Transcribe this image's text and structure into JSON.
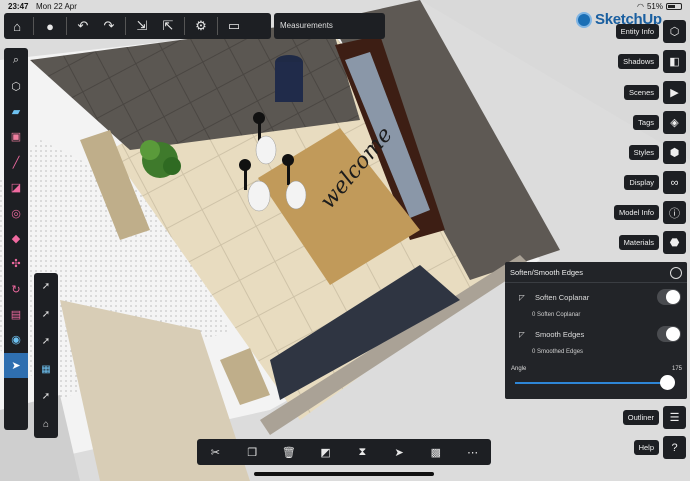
{
  "status": {
    "time": "23:47",
    "date": "Mon 22 Apr",
    "battery": "51%"
  },
  "logo": {
    "text": "SketchUp"
  },
  "measurements": {
    "label": "Measurements"
  },
  "top_toolbar": {
    "icons": [
      "home-icon",
      "user-icon",
      "undo-icon",
      "redo-icon",
      "import-icon",
      "export-icon",
      "settings-icon",
      "view-icon"
    ]
  },
  "left_tools": [
    "search-icon",
    "orbit-icon",
    "eraser-icon",
    "push-pull-icon",
    "line-icon",
    "rectangle-icon",
    "circle-icon",
    "paint-icon",
    "move-icon",
    "rotate-icon",
    "section-icon",
    "tape-icon",
    "select-icon"
  ],
  "sub_tools": [
    "arrow-plus-icon",
    "arrow-icon",
    "arrow-plus-icon",
    "grid-icon",
    "arrow-plus-icon",
    "hat-icon"
  ],
  "right_panel": [
    {
      "label": "Entity Info",
      "icon": "cube-icon"
    },
    {
      "label": "Shadows",
      "icon": "shadow-icon"
    },
    {
      "label": "Scenes",
      "icon": "scene-icon"
    },
    {
      "label": "Tags",
      "icon": "tag-icon"
    },
    {
      "label": "Styles",
      "icon": "styles-icon"
    },
    {
      "label": "Display",
      "icon": "glasses-icon"
    },
    {
      "label": "Model Info",
      "icon": "info-icon"
    },
    {
      "label": "Materials",
      "icon": "materials-icon"
    }
  ],
  "soften": {
    "title": "Soften/Smooth Edges",
    "soften_label": "Soften Coplanar",
    "soften_sub": "0 Soften Coplanar",
    "smooth_label": "Smooth Edges",
    "smooth_sub": "0 Smoothed Edges",
    "angle_label": "Angle",
    "angle_value": "175"
  },
  "bottom_right": [
    {
      "label": "Outliner",
      "icon": "outliner-icon"
    },
    {
      "label": "Help",
      "icon": "help-icon"
    }
  ],
  "bottom_toolbar": {
    "icons": [
      "scissors-icon",
      "copy-icon",
      "trash-icon",
      "paint-tool-icon",
      "hourglass-icon",
      "cursor-icon",
      "checker-icon",
      "more-icon"
    ]
  },
  "doormat_text": "welcome"
}
